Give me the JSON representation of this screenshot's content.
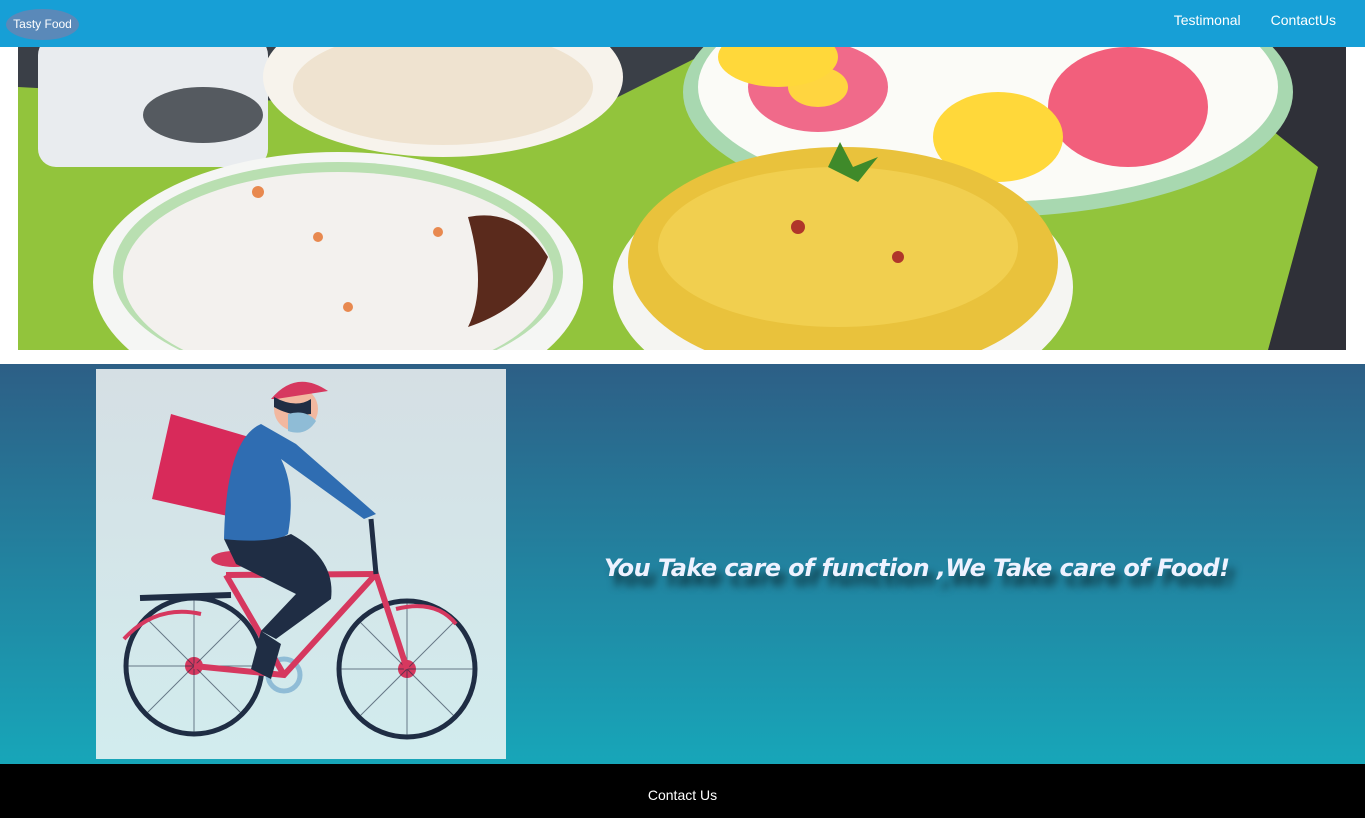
{
  "navbar": {
    "brand": "Tasty Food",
    "links": [
      {
        "label": "Testimonal"
      },
      {
        "label": "ContactUs"
      }
    ],
    "color": "#179fd6"
  },
  "promo": {
    "tagline": "You Take care of function ,We Take care of Food!"
  },
  "footer": {
    "link_label": "Contact Us"
  },
  "icons": [
    "food-hero-image",
    "delivery-rider-illustration"
  ]
}
